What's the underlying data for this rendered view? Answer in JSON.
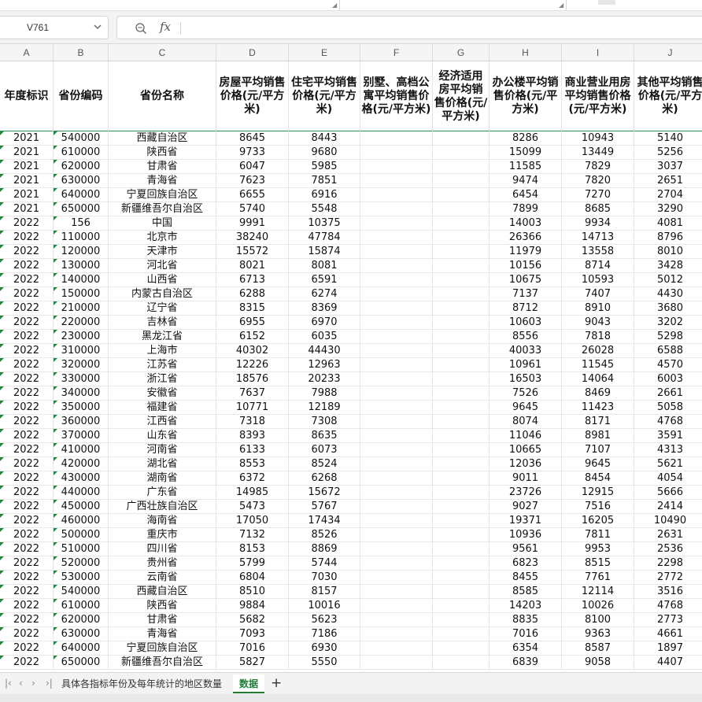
{
  "name_box": {
    "value": "V761"
  },
  "formula": {
    "fx_label": "fx",
    "content": ""
  },
  "column_letters": [
    "A",
    "B",
    "C",
    "D",
    "E",
    "F",
    "G",
    "H",
    "I",
    "J"
  ],
  "headers": [
    "年度标识",
    "省份编码",
    "省份名称",
    "房屋平均销售价格(元/平方米)",
    "住宅平均销售价格(元/平方米)",
    "别墅、高档公寓平均销售价格(元/平方米)",
    "经济适用房平均销售价格(元/平方米)",
    "办公楼平均销售价格(元/平方米)",
    "商业营业用房平均销售价格(元/平方米)",
    "其他平均销售价格(元/平方米)"
  ],
  "rows": [
    [
      "2021",
      "540000",
      "西藏自治区",
      "8645",
      "8443",
      "",
      "",
      "8286",
      "10943",
      "5140"
    ],
    [
      "2021",
      "610000",
      "陕西省",
      "9733",
      "9680",
      "",
      "",
      "15099",
      "13449",
      "5256"
    ],
    [
      "2021",
      "620000",
      "甘肃省",
      "6047",
      "5985",
      "",
      "",
      "11585",
      "7829",
      "3037"
    ],
    [
      "2021",
      "630000",
      "青海省",
      "7623",
      "7851",
      "",
      "",
      "9474",
      "7820",
      "2651"
    ],
    [
      "2021",
      "640000",
      "宁夏回族自治区",
      "6655",
      "6916",
      "",
      "",
      "6454",
      "7270",
      "2704"
    ],
    [
      "2021",
      "650000",
      "新疆维吾尔自治区",
      "5740",
      "5548",
      "",
      "",
      "7899",
      "8685",
      "3290"
    ],
    [
      "2022",
      "156",
      "中国",
      "9991",
      "10375",
      "",
      "",
      "14003",
      "9934",
      "4081"
    ],
    [
      "2022",
      "110000",
      "北京市",
      "38240",
      "47784",
      "",
      "",
      "26366",
      "14713",
      "8796"
    ],
    [
      "2022",
      "120000",
      "天津市",
      "15572",
      "15874",
      "",
      "",
      "11979",
      "13558",
      "8010"
    ],
    [
      "2022",
      "130000",
      "河北省",
      "8021",
      "8081",
      "",
      "",
      "10156",
      "8714",
      "3428"
    ],
    [
      "2022",
      "140000",
      "山西省",
      "6713",
      "6591",
      "",
      "",
      "10675",
      "10593",
      "5012"
    ],
    [
      "2022",
      "150000",
      "内蒙古自治区",
      "6288",
      "6274",
      "",
      "",
      "7137",
      "7407",
      "4430"
    ],
    [
      "2022",
      "210000",
      "辽宁省",
      "8315",
      "8369",
      "",
      "",
      "8712",
      "8910",
      "3680"
    ],
    [
      "2022",
      "220000",
      "吉林省",
      "6955",
      "6970",
      "",
      "",
      "10603",
      "9043",
      "3202"
    ],
    [
      "2022",
      "230000",
      "黑龙江省",
      "6152",
      "6035",
      "",
      "",
      "8556",
      "7818",
      "5298"
    ],
    [
      "2022",
      "310000",
      "上海市",
      "40302",
      "44430",
      "",
      "",
      "40033",
      "26028",
      "6588"
    ],
    [
      "2022",
      "320000",
      "江苏省",
      "12226",
      "12963",
      "",
      "",
      "10961",
      "11545",
      "4570"
    ],
    [
      "2022",
      "330000",
      "浙江省",
      "18576",
      "20233",
      "",
      "",
      "16503",
      "14064",
      "6003"
    ],
    [
      "2022",
      "340000",
      "安徽省",
      "7637",
      "7988",
      "",
      "",
      "7526",
      "8469",
      "2661"
    ],
    [
      "2022",
      "350000",
      "福建省",
      "10771",
      "12189",
      "",
      "",
      "9645",
      "11423",
      "5058"
    ],
    [
      "2022",
      "360000",
      "江西省",
      "7318",
      "7308",
      "",
      "",
      "8074",
      "8171",
      "4768"
    ],
    [
      "2022",
      "370000",
      "山东省",
      "8393",
      "8635",
      "",
      "",
      "11046",
      "8981",
      "3591"
    ],
    [
      "2022",
      "410000",
      "河南省",
      "6133",
      "6073",
      "",
      "",
      "10665",
      "7107",
      "4313"
    ],
    [
      "2022",
      "420000",
      "湖北省",
      "8553",
      "8524",
      "",
      "",
      "12036",
      "9645",
      "5621"
    ],
    [
      "2022",
      "430000",
      "湖南省",
      "6372",
      "6268",
      "",
      "",
      "9011",
      "8454",
      "4054"
    ],
    [
      "2022",
      "440000",
      "广东省",
      "14985",
      "15672",
      "",
      "",
      "23726",
      "12915",
      "5666"
    ],
    [
      "2022",
      "450000",
      "广西壮族自治区",
      "5473",
      "5767",
      "",
      "",
      "9027",
      "7516",
      "2414"
    ],
    [
      "2022",
      "460000",
      "海南省",
      "17050",
      "17434",
      "",
      "",
      "19371",
      "16205",
      "10490"
    ],
    [
      "2022",
      "500000",
      "重庆市",
      "7132",
      "8526",
      "",
      "",
      "10936",
      "7811",
      "2631"
    ],
    [
      "2022",
      "510000",
      "四川省",
      "8153",
      "8869",
      "",
      "",
      "9561",
      "9953",
      "2536"
    ],
    [
      "2022",
      "520000",
      "贵州省",
      "5799",
      "5744",
      "",
      "",
      "6823",
      "8515",
      "2298"
    ],
    [
      "2022",
      "530000",
      "云南省",
      "6804",
      "7030",
      "",
      "",
      "8455",
      "7761",
      "2772"
    ],
    [
      "2022",
      "540000",
      "西藏自治区",
      "8510",
      "8157",
      "",
      "",
      "8585",
      "12114",
      "3516"
    ],
    [
      "2022",
      "610000",
      "陕西省",
      "9884",
      "10016",
      "",
      "",
      "14203",
      "10026",
      "4768"
    ],
    [
      "2022",
      "620000",
      "甘肃省",
      "5682",
      "5623",
      "",
      "",
      "8835",
      "8100",
      "2773"
    ],
    [
      "2022",
      "630000",
      "青海省",
      "7093",
      "7186",
      "",
      "",
      "7016",
      "9363",
      "4661"
    ],
    [
      "2022",
      "640000",
      "宁夏回族自治区",
      "7016",
      "6930",
      "",
      "",
      "6354",
      "8587",
      "1897"
    ],
    [
      "2022",
      "650000",
      "新疆维吾尔自治区",
      "5827",
      "5550",
      "",
      "",
      "6839",
      "9058",
      "4407"
    ]
  ],
  "sheet_tabs": [
    "具体各指标年份及每年统计的地区数量",
    "数据"
  ],
  "active_tab": "数据",
  "nav": {
    "prev_label": "‹",
    "next_label": "›",
    "last_label": "›|",
    "first_label": "|‹",
    "add_label": "+"
  },
  "colors": {
    "accent": "#1e7e34",
    "header_border": "#2e8b57"
  }
}
